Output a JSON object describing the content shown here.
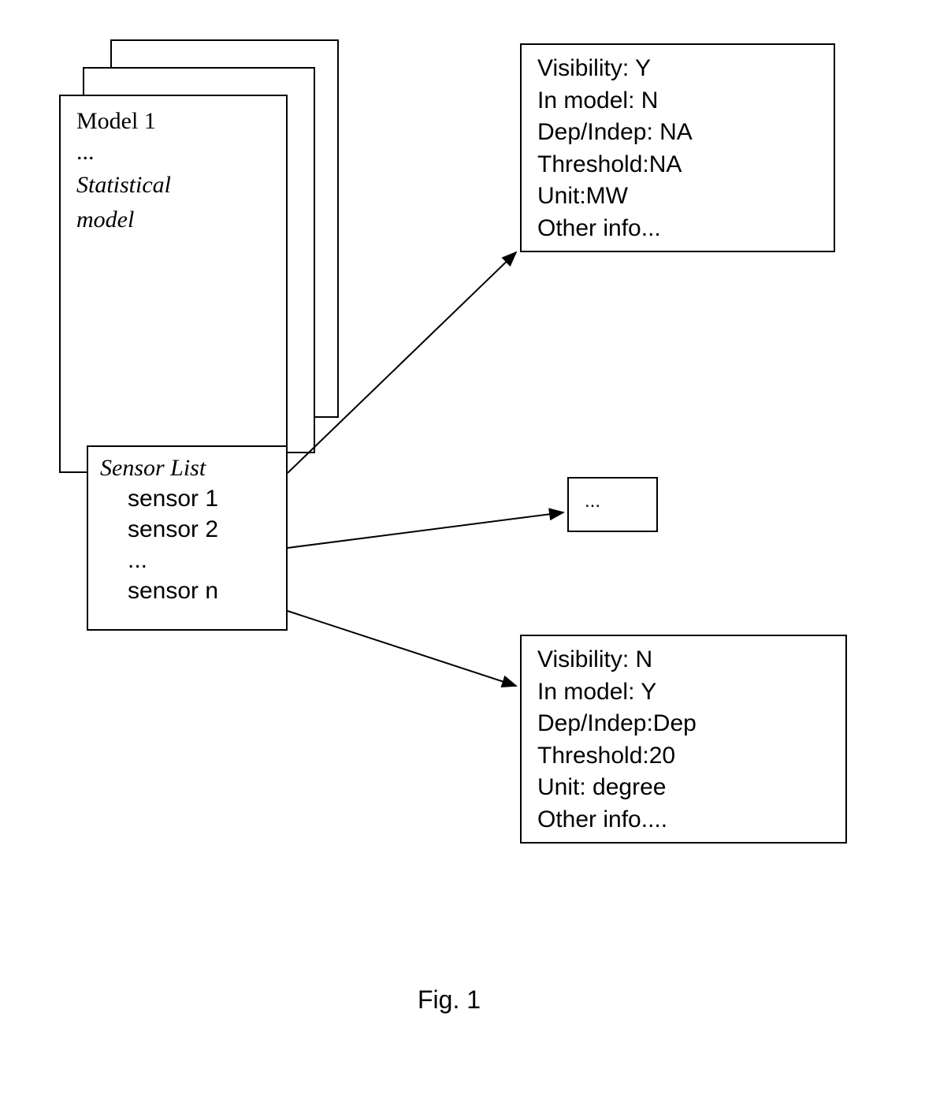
{
  "model_card": {
    "title": "Model 1",
    "ellipsis": "...",
    "subtitle_line1": "Statistical",
    "subtitle_line2": "model"
  },
  "sensor_list": {
    "title": "Sensor List",
    "items": [
      "sensor 1",
      "sensor 2",
      "...",
      "sensor n"
    ]
  },
  "detail_box_1": {
    "visibility": "Visibility: Y",
    "in_model": "In model: N",
    "dep_indep": "Dep/Indep: NA",
    "threshold": "Threshold:NA",
    "unit": "Unit:MW",
    "other": "Other info..."
  },
  "detail_box_2": {
    "text": "..."
  },
  "detail_box_3": {
    "visibility": "Visibility: N",
    "in_model": "In model: Y",
    "dep_indep": "Dep/Indep:Dep",
    "threshold": "Threshold:20",
    "unit": "Unit: degree",
    "other": "Other info...."
  },
  "caption": "Fig. 1"
}
